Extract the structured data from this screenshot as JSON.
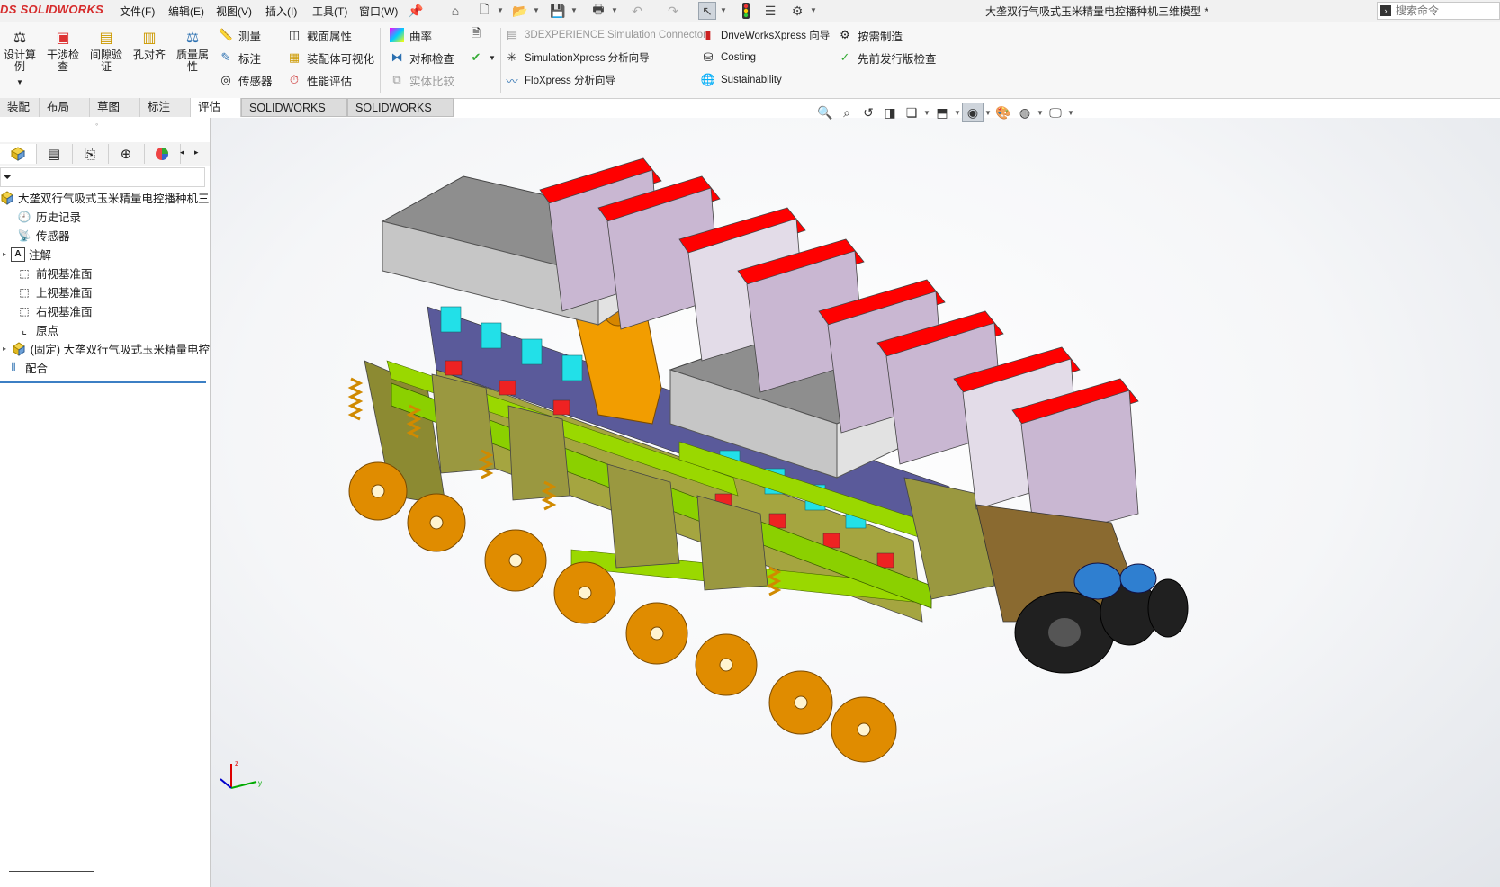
{
  "app": {
    "logo": "DS SOLIDWORKS",
    "title": "大垄双行气吸式玉米精量电控播种机三维模型 *"
  },
  "menu": [
    "文件(F)",
    "编辑(E)",
    "视图(V)",
    "插入(I)",
    "工具(T)",
    "窗口(W)"
  ],
  "search": {
    "placeholder": "搜索命令"
  },
  "ribbon": {
    "big_buttons": [
      {
        "label": "设计算\n例",
        "icon": "design-study-icon"
      },
      {
        "label": "干涉检\n查",
        "icon": "interference-check-icon"
      },
      {
        "label": "间隙验\n证",
        "icon": "clearance-icon"
      },
      {
        "label": "孔对齐",
        "icon": "hole-align-icon"
      },
      {
        "label": "质量属\n性",
        "icon": "mass-properties-icon"
      }
    ],
    "col1": [
      "测量",
      "标注",
      "传感器"
    ],
    "col2": [
      "截面属性",
      "装配体可视化",
      "性能评估"
    ],
    "col3": [
      "曲率",
      "对称检查",
      "实体比较"
    ],
    "col4": [
      "3DEXPERIENCE Simulation Connector",
      "SimulationXpress 分析向导",
      "FloXpress 分析向导"
    ],
    "col5": [
      "DriveWorksXpress 向导",
      "Costing",
      "Sustainability"
    ],
    "col6": [
      "按需制造",
      "先前发行版检查"
    ]
  },
  "tabs": [
    {
      "label": "装配体",
      "active": false
    },
    {
      "label": "布局",
      "active": false
    },
    {
      "label": "草图",
      "active": false
    },
    {
      "label": "标注",
      "active": false
    },
    {
      "label": "评估",
      "active": true
    },
    {
      "label": "SOLIDWORKS 插件",
      "active": false
    },
    {
      "label": "SOLIDWORKS CAM",
      "active": false
    }
  ],
  "tree": [
    {
      "label": "大垄双行气吸式玉米精量电控播种机三维",
      "icon": "assembly-icon",
      "expander": "",
      "indent": 0
    },
    {
      "label": "历史记录",
      "icon": "history-icon",
      "expander": "",
      "indent": 1
    },
    {
      "label": "传感器",
      "icon": "sensor-icon",
      "expander": "",
      "indent": 1
    },
    {
      "label": "注解",
      "icon": "annotation-icon",
      "expander": "▸",
      "indent": 1
    },
    {
      "label": "前视基准面",
      "icon": "plane-icon",
      "expander": "",
      "indent": 1
    },
    {
      "label": "上视基准面",
      "icon": "plane-icon",
      "expander": "",
      "indent": 1
    },
    {
      "label": "右视基准面",
      "icon": "plane-icon",
      "expander": "",
      "indent": 1
    },
    {
      "label": "原点",
      "icon": "origin-icon",
      "expander": "",
      "indent": 1
    },
    {
      "label": "(固定) 大垄双行气吸式玉米精量电控",
      "icon": "subassembly-icon",
      "expander": "▸",
      "indent": 1
    },
    {
      "label": "配合",
      "icon": "mates-icon",
      "expander": "",
      "indent": 1
    }
  ],
  "colors": {
    "accent": "#3c7fc4",
    "hopper_lid": "#ff0000",
    "frame": "#9acd32",
    "wheels": "#e08c00",
    "hopper": "#b39cc0",
    "tank": "#8a8a8a"
  }
}
